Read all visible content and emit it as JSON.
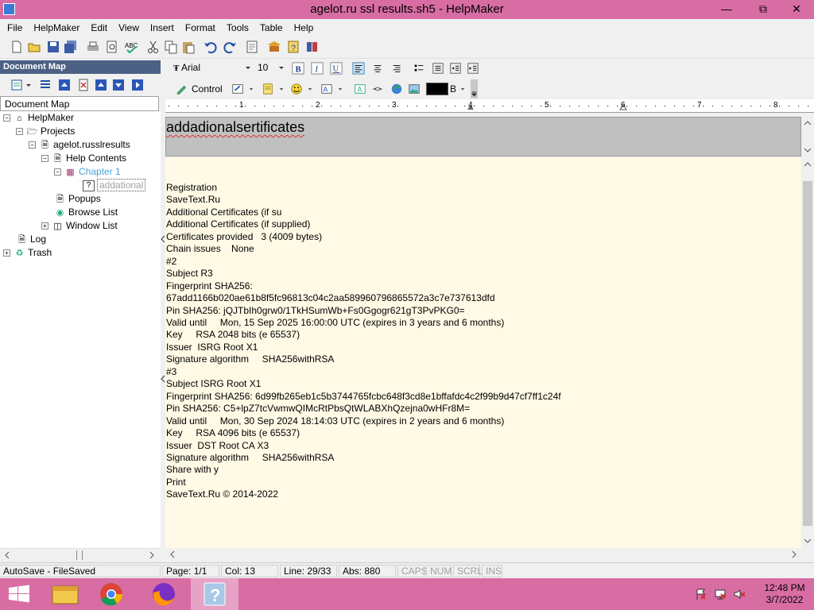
{
  "window": {
    "title": "agelot.ru ssl results.sh5 - HelpMaker"
  },
  "menu": [
    "File",
    "HelpMaker",
    "Edit",
    "View",
    "Insert",
    "Format",
    "Tools",
    "Table",
    "Help"
  ],
  "docmap": {
    "header": "Document Map",
    "label": "Document Map"
  },
  "tree": {
    "root": "HelpMaker",
    "projects": "Projects",
    "project": "agelot.russlresults",
    "help_contents": "Help Contents",
    "chapter": "Chapter 1",
    "topic": "addational",
    "popups": "Popups",
    "browse_list": "Browse List",
    "window_list": "Window List",
    "log": "Log",
    "trash": "Trash"
  },
  "format": {
    "font": "Arial",
    "size": "10",
    "control_label": "Control",
    "color_label": "B",
    "text_color": "#000000"
  },
  "ruler": [
    "1",
    "2",
    "3",
    "4",
    "5",
    "6",
    "7",
    "8"
  ],
  "topic_title": "addadionalsertificates",
  "content_lines": [
    "Registration",
    "SaveText.Ru",
    "Additional Certificates (if su",
    "Additional Certificates (if supplied)",
    "Certificates provided   3 (4009 bytes)",
    "Chain issues    None",
    "#2",
    "Subject R3",
    "Fingerprint SHA256:",
    "67add1166b020ae61b8f5fc96813c04c2aa589960796865572a3c7e737613dfd",
    "Pin SHA256: jQJTbIh0grw0/1TkHSumWb+Fs0Ggogr621gT3PvPKG0=",
    "Valid until     Mon, 15 Sep 2025 16:00:00 UTC (expires in 3 years and 6 months)",
    "Key     RSA 2048 bits (e 65537)",
    "Issuer  ISRG Root X1",
    "Signature algorithm     SHA256withRSA",
    "#3",
    "Subject ISRG Root X1",
    "Fingerprint SHA256: 6d99fb265eb1c5b3744765fcbc648f3cd8e1bffafdc4c2f99b9d47cf7ff1c24f",
    "Pin SHA256: C5+lpZ7tcVwmwQIMcRtPbsQtWLABXhQzejna0wHFr8M=",
    "Valid until     Mon, 30 Sep 2024 18:14:03 UTC (expires in 2 years and 6 months)",
    "Key     RSA 4096 bits (e 65537)",
    "Issuer  DST Root CA X3",
    "Signature algorithm     SHA256withRSA",
    "Share with y",
    "Print",
    "SaveText.Ru © 2014-2022"
  ],
  "status": {
    "autosave": "AutoSave - FileSaved",
    "page": "Page: 1/1",
    "col": "Col: 13",
    "line": "Line: 29/33",
    "abs": "Abs: 880",
    "caps": "CAPS",
    "num": "NUM",
    "scrl": "SCRL",
    "ins": "INS"
  },
  "clock": {
    "time": "12:48 PM",
    "date": "3/7/2022"
  },
  "colors": {
    "titlebar": "#d86da4",
    "docmap_header": "#4d6185",
    "editor_bg": "#fff9e5",
    "chapter_text": "#4aa3df"
  }
}
